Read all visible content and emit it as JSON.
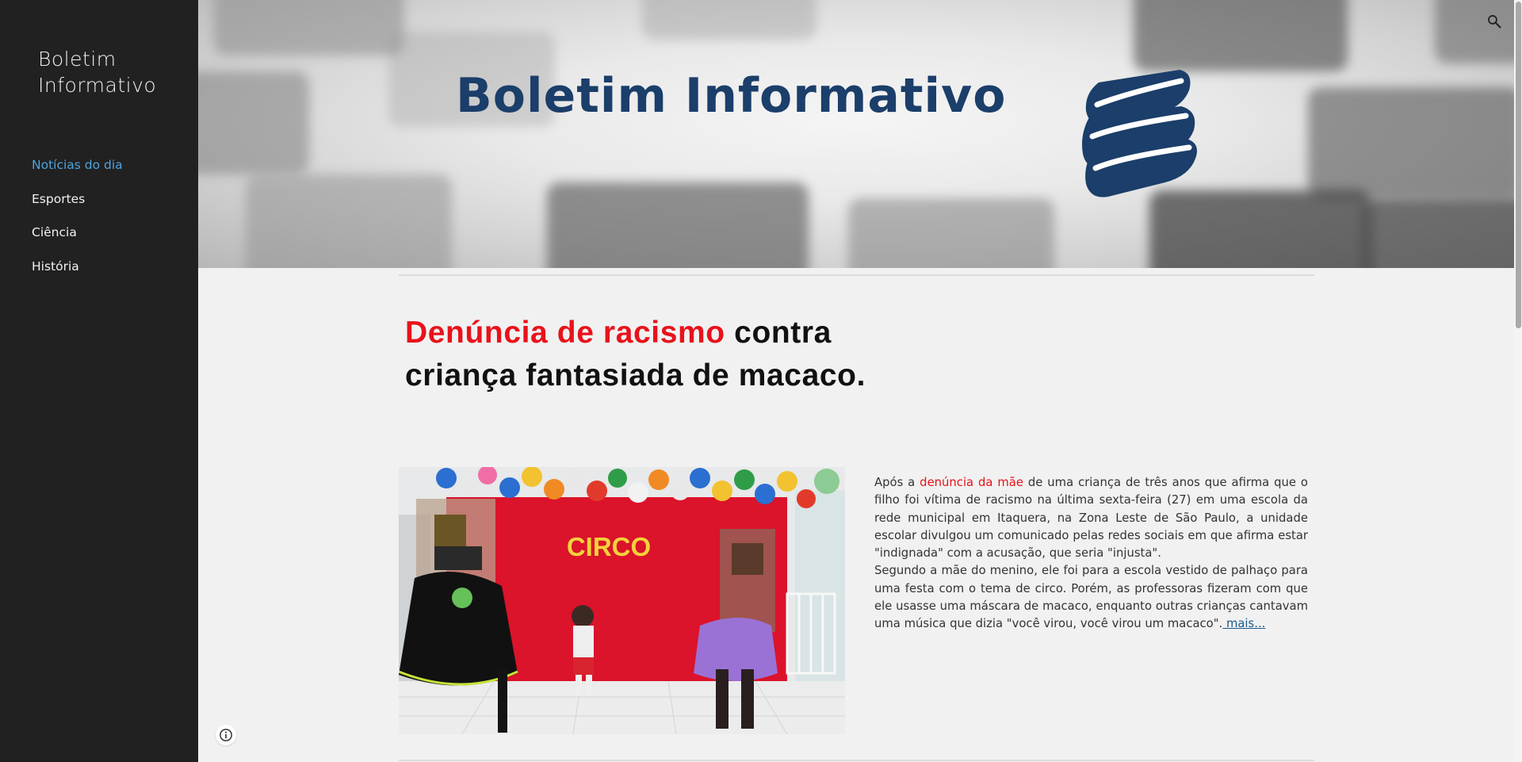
{
  "sidebar": {
    "site_title": "Boletim Informativo",
    "nav_items": [
      {
        "label": "Notícias do dia",
        "active": true
      },
      {
        "label": "Esportes",
        "active": false
      },
      {
        "label": "Ciência",
        "active": false
      },
      {
        "label": "História",
        "active": false
      }
    ],
    "info_icon": "info-icon"
  },
  "header": {
    "title": "Boletim Informativo",
    "icon": "books-icon",
    "search_icon": "search-icon"
  },
  "article": {
    "headline_red": "Denúncia de racismo",
    "headline_rest": " contra criança fantasiada de macaco.",
    "photo_banner_text": "CIRCO",
    "p1_start": "Após a ",
    "p1_red": "denúncia da mãe",
    "p1_rest": " de uma criança de três anos que afirma que o filho foi vítima de racismo na última sexta-feira (27) em uma escola da rede municipal em Itaquera, na Zona Leste de São Paulo, a unidade escolar divulgou um comunicado pelas redes sociais em que afirma estar \"indignada\" com a acusação, que seria \"injusta\".",
    "p2": "Segundo a mãe do menino, ele foi para a escola vestido de palhaço para uma festa com o tema de circo. Porém, as professoras fizeram com que ele usasse uma máscara de macaco, enquanto outras crianças cantavam uma música que dizia \"você virou, você virou um macaco\".",
    "more_link": " mais..."
  },
  "colors": {
    "sidebar_bg": "#212121",
    "nav_active": "#4fa3dc",
    "header_title": "#1b3e6a",
    "headline_red": "#e8121b",
    "page_bg": "#f1f1f1"
  }
}
